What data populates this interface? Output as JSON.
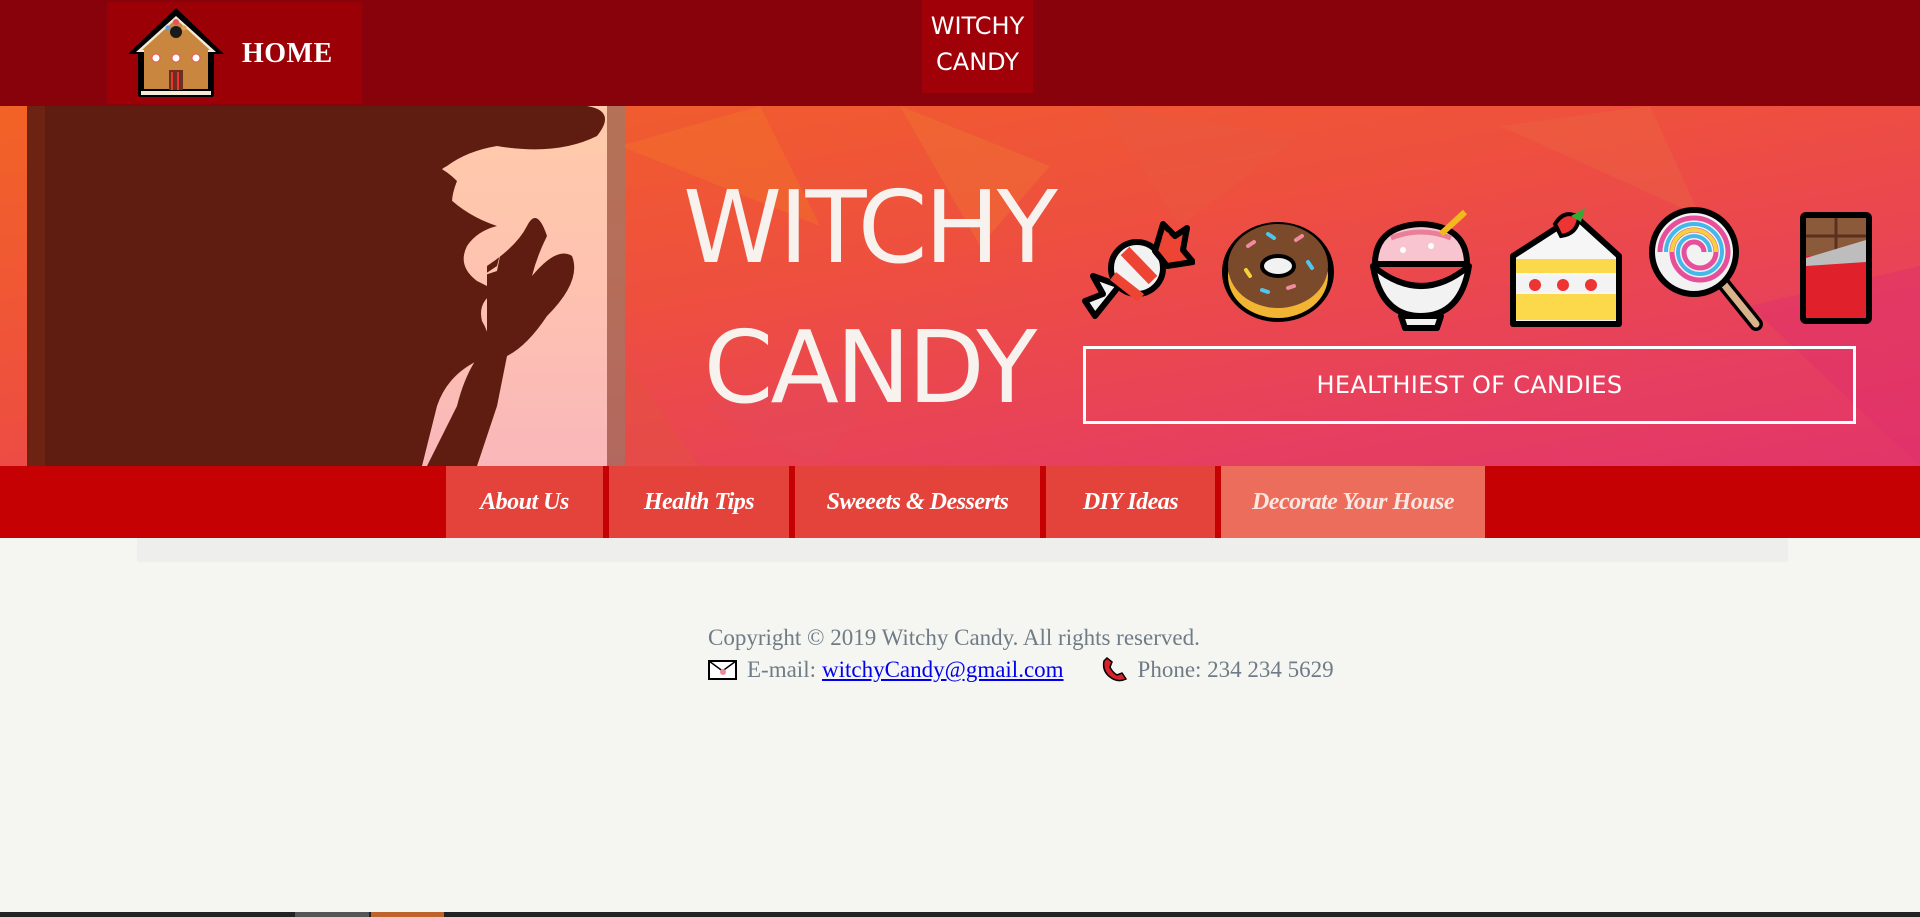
{
  "topbar": {
    "home_label": "HOME",
    "brand_line1": "WITCHY",
    "brand_line2": "CANDY"
  },
  "banner": {
    "title_line1": "WITCHY",
    "title_line2": "CANDY",
    "tagline": "HEALTHIEST OF CANDIES",
    "candy_icons": [
      "candy-icon",
      "doughnut-icon",
      "shaved-ice-icon",
      "shortcake-icon",
      "lollipop-icon",
      "chocolate-bar-icon"
    ]
  },
  "nav": {
    "items": [
      {
        "label": "About Us"
      },
      {
        "label": "Health Tips"
      },
      {
        "label": "Sweeets & Desserts"
      },
      {
        "label": "DIY Ideas"
      },
      {
        "label": "Decorate Your House"
      }
    ],
    "active_index": 4
  },
  "footer": {
    "copyright": "Copyright © 2019 Witchy Candy. All rights reserved.",
    "email_label": "E-mail:",
    "email": "witchyCandy@gmail.com",
    "phone_label": "Phone: 234 234 5629"
  },
  "colors": {
    "topbar": "#88020c",
    "nav": "#c60103",
    "nav_item": "#e4433b",
    "nav_active": "#ec6d5c",
    "link": "#0000ee"
  }
}
